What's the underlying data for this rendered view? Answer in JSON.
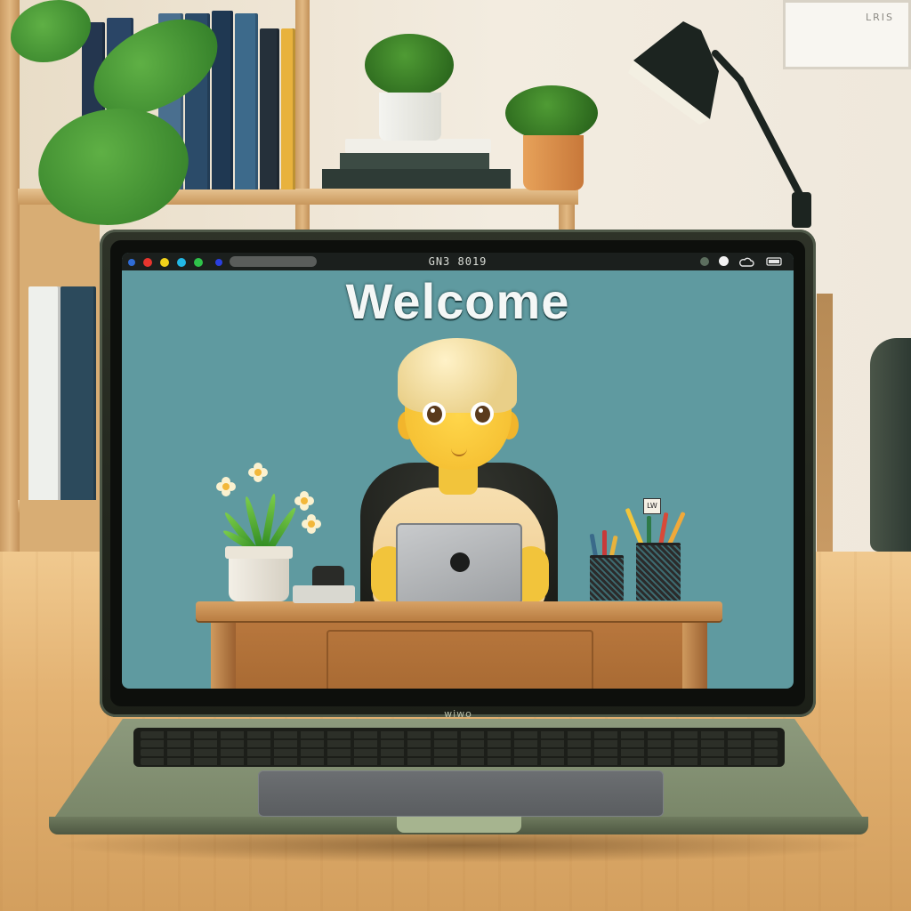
{
  "scene": {
    "description_free": true,
    "background_frame_text": "LRIS",
    "laptop_brand_text": "wiwo"
  },
  "screen": {
    "menubar": {
      "title": "GN3 8019",
      "dots": [
        {
          "color": "#2f6cd6"
        },
        {
          "color": "#e8352e"
        },
        {
          "color": "#f2d21a"
        },
        {
          "color": "#22b8e6"
        },
        {
          "color": "#2fc24a"
        },
        {
          "color": "#2a3fe0"
        }
      ],
      "system_icons": [
        "status-dot-icon",
        "toggle-dot-icon",
        "cloud-icon",
        "battery-icon"
      ]
    },
    "welcome_text": "Welcome",
    "illustration": {
      "desk_sign_text": "LW"
    }
  },
  "colors": {
    "screen_bg": "#5f9aa0",
    "welcome_text": "#f4f7f6",
    "laptop_body": "#788567"
  }
}
